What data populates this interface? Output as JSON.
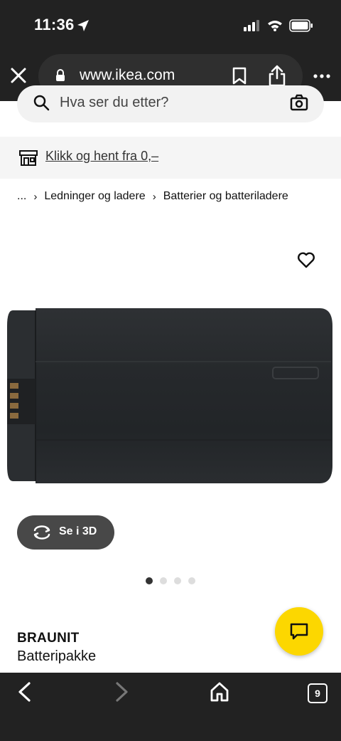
{
  "status_bar": {
    "time": "11:36"
  },
  "browser": {
    "url": "www.ikea.com",
    "tab_count": "9"
  },
  "search": {
    "placeholder": "Hva ser du etter?"
  },
  "pickup": {
    "link_text": "Klikk og hent fra 0,–"
  },
  "breadcrumb": {
    "ellipsis": "...",
    "items": [
      "Ledninger og ladere",
      "Batterier og batteriladere"
    ]
  },
  "product": {
    "brand": "BRAUNIT",
    "type": "Batteripakke",
    "view_3d_label": "Se i 3D",
    "image_count": 4,
    "active_image": 1
  },
  "colors": {
    "accent_yellow": "#fcd700",
    "chrome_dark": "#222222"
  }
}
